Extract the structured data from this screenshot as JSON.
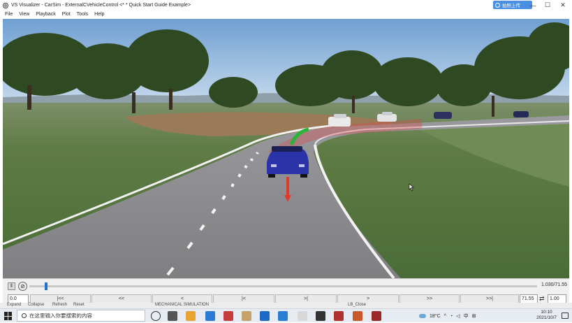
{
  "window": {
    "title": "VS Visualizer - CarSim - ExternalCVehicleControl <* * Quick Start Guide Example>",
    "upload_label": "拍照上传",
    "minimize": "—",
    "maximize": "☐",
    "close": "✕"
  },
  "menu": [
    "File",
    "View",
    "Playback",
    "Plot",
    "Tools",
    "Help"
  ],
  "scene": {
    "sky_color": "#7fa9d6",
    "grass_color": "#5b7a45",
    "road_color": "#8e8e90",
    "vehicle_color": "#2b33a8"
  },
  "playback": {
    "pause_icon": "pause-icon",
    "time_display": "1.030/71.55",
    "progress_fraction": 0.014,
    "start_value": "0.0",
    "end_value": "71.55",
    "speed_value": "1.00",
    "step_buttons": [
      "|<<",
      "<<",
      "<",
      "|<",
      ">|",
      ">",
      ">>",
      ">>|"
    ]
  },
  "panel_strip": {
    "items": [
      "Expand",
      "Collapse",
      "Refresh",
      "Reset",
      "MECHANICAL SIMULATION",
      "LB_Close"
    ]
  },
  "taskbar": {
    "search_placeholder": "在这里输入你要搜索的内容",
    "temperature": "18°C",
    "ime": "中",
    "time": "10:10",
    "date": "2021/10/7",
    "app_colors": [
      "#3b3b3b",
      "#555555",
      "#e8a430",
      "#2a7ad6",
      "#c43c3c",
      "#c4a26a",
      "#1d69c4",
      "#2b7cd3",
      "#d8d8d8",
      "#333333",
      "#b03030",
      "#c9582a",
      "#9a2a2a"
    ]
  }
}
